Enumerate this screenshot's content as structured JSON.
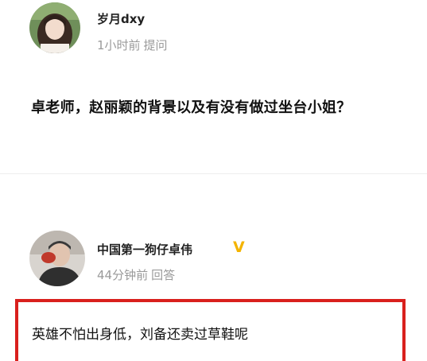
{
  "question_post": {
    "author_name": "岁月dxy",
    "time": "1小时前",
    "action": "提问",
    "text": "卓老师，赵丽颖的背景以及有没有做过坐台小姐？"
  },
  "answer_post": {
    "author_name": "中国第一狗仔卓伟",
    "verified_badge": "V",
    "time": "44分钟前",
    "action": "回答",
    "text": "英雄不怕出身低，刘备还卖过草鞋呢"
  },
  "colors": {
    "highlight_border": "#d9201d",
    "verified_badge": "#f4b400",
    "meta_text": "#9a9a9a"
  }
}
